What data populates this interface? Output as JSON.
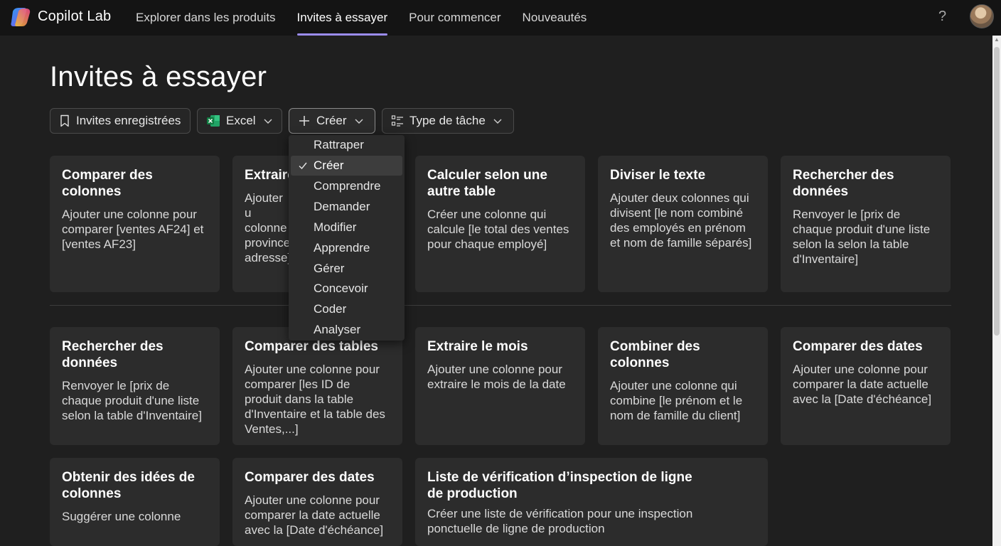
{
  "app": {
    "name": "Copilot Lab"
  },
  "nav": [
    {
      "label": "Explorer dans les produits"
    },
    {
      "label": "Invites à essayer"
    },
    {
      "label": "Pour commencer"
    },
    {
      "label": "Nouveautés"
    }
  ],
  "help": "?",
  "page": {
    "title": "Invites à essayer"
  },
  "filters": {
    "saved": "Invites enregistrées",
    "app": "Excel",
    "create": "Créer",
    "task_type": "Type de tâche"
  },
  "menu": {
    "items": [
      "Rattraper",
      "Créer",
      "Comprendre",
      "Demander",
      "Modifier",
      "Apprendre",
      "Gérer",
      "Concevoir",
      "Coder",
      "Analyser"
    ],
    "selected": "Créer"
  },
  "cards": [
    {
      "title": "Comparer des colonnes",
      "desc": "Ajouter une colonne pour comparer [ventes AF24] et [ventes AF23]"
    },
    {
      "title": "Extraire",
      "desc": "Ajouter u colonne province adresse]"
    },
    {
      "title": "Calculer selon une autre table",
      "desc": "Créer une colonne qui calcule [le total des ventes pour chaque employé]"
    },
    {
      "title": "Diviser le texte",
      "desc": "Ajouter deux colonnes qui divisent [le nom combiné des employés en prénom et nom de famille séparés]"
    },
    {
      "title": "Rechercher des données",
      "desc": "Renvoyer le [prix de chaque produit d'une liste selon la selon la table d'Inventaire]"
    },
    {
      "title": "Rechercher des données",
      "desc": "Renvoyer le [prix de chaque produit d'une liste selon la table d'Inventaire]"
    },
    {
      "title": "Comparer des tables",
      "desc": "Ajouter une colonne pour comparer [les ID de produit dans la table d'Inventaire et la table des Ventes,...]"
    },
    {
      "title": "Extraire le mois",
      "desc": "Ajouter une colonne pour extraire le mois de la date"
    },
    {
      "title": "Combiner des colonnes",
      "desc": "Ajouter une colonne qui combine [le prénom et le nom de famille du client]"
    },
    {
      "title": "Comparer des dates",
      "desc": "Ajouter une colonne pour comparer la date actuelle avec la [Date d'échéance]"
    },
    {
      "title": "Obtenir des idées de colonnes",
      "desc": "Suggérer une colonne"
    },
    {
      "title": "Comparer des dates",
      "desc": "Ajouter une colonne pour comparer la date actuelle avec la [Date d'échéance]"
    },
    {
      "title": "Liste de vérification d’inspection de ligne de production",
      "desc": "Créer une liste de vérification pour une inspection ponctuelle de ligne de production"
    }
  ]
}
